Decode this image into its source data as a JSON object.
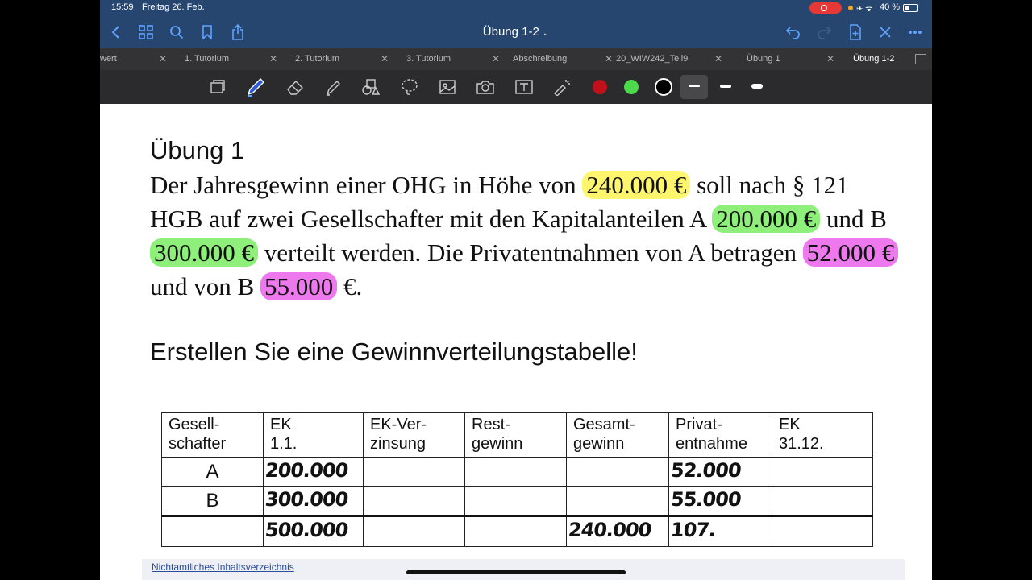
{
  "status": {
    "time": "15:59",
    "date": "Freitag 26. Feb.",
    "battery": "40 %"
  },
  "nav": {
    "title": "Übung 1-2",
    "chevron": "⌄"
  },
  "tabs": [
    {
      "label": "wert"
    },
    {
      "label": "1. Tutorium"
    },
    {
      "label": "2. Tutorium"
    },
    {
      "label": "3. Tutorium"
    },
    {
      "label": "Abschreibung"
    },
    {
      "label": "20_WIW242_Teil9"
    },
    {
      "label": "Übung 1"
    },
    {
      "label": "Übung 1-2"
    }
  ],
  "toolbar": {
    "colors": [
      "#c0111a",
      "#4cd94c",
      "#000000"
    ]
  },
  "doc": {
    "heading": "Übung 1",
    "para": {
      "p1": "Der Jahresgewinn einer OHG in Höhe von",
      "v1": "240.000 €",
      "p2": "soll nach § 121 HGB auf zwei Gesellschafter mit den Kapitalanteilen A",
      "v2": "200.000 €",
      "p3": "und B",
      "v3": "300.000 €",
      "p4": "verteilt werden. Die Privatentnahmen von A betragen",
      "v4": "52.000 €",
      "p5": "und von B",
      "v5": "55.000",
      "p6": "€."
    },
    "task": "Erstellen Sie eine Gewinnverteilungstabelle!",
    "table": {
      "headers": [
        [
          "Gesell-",
          "schafter"
        ],
        [
          "EK",
          "1.1."
        ],
        [
          "EK-Ver-",
          "zinsung"
        ],
        [
          "Rest-",
          "gewinn"
        ],
        [
          "Gesamt-",
          "gewinn"
        ],
        [
          "Privat-",
          "entnahme"
        ],
        [
          "EK",
          "31.12."
        ]
      ],
      "rows": [
        {
          "label": "A",
          "ek": "200.000",
          "privat": "52.000"
        },
        {
          "label": "B",
          "ek": "300.000",
          "privat": "55.000"
        }
      ],
      "sum": {
        "ek": "500.000",
        "gesamt": "240.000",
        "privat": "107."
      }
    },
    "footer_link": "Nichtamtliches Inhaltsverzeichnis"
  }
}
